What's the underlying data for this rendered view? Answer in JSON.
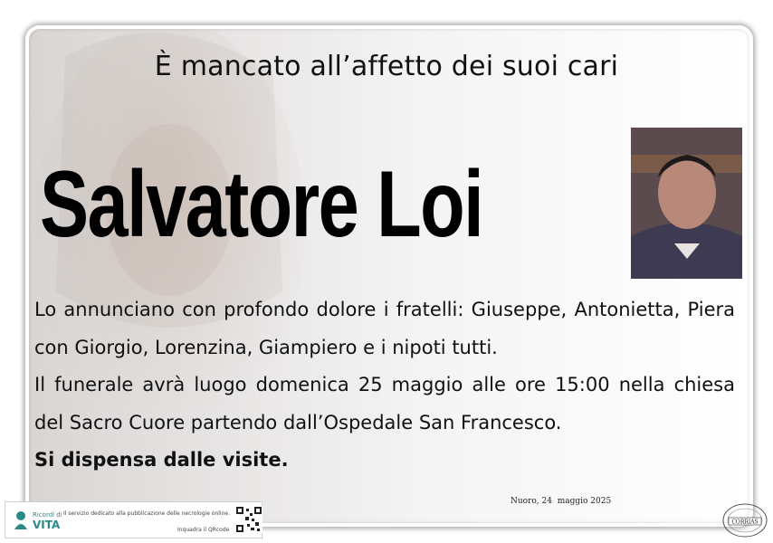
{
  "notice": {
    "heading": "È mancato all’affetto dei suoi cari",
    "name": "Salvatore Loi",
    "lines": [
      "Lo annunciano con profondo dolore i fratelli: Giuseppe, Antonietta, Piera con Giorgio, Lorenzina, Giampiero e i nipoti tutti.",
      "Il funerale avrà luogo domenica 25 maggio alle ore 15:00 nella chiesa del Sacro Cuore partendo dall’Ospedale San Francesco."
    ],
    "closing": "Si dispensa  dalle visite.",
    "date": "Nuoro, 24  maggio 2025"
  },
  "footer": {
    "brand_small": "Ricordi di",
    "brand_big": "VITA",
    "service_text": "Il servizio dedicato alla pubblicazione delle necrologie online.",
    "qr_hint": "Inquadra il QRcode",
    "seal_text": "CORRIAS"
  },
  "colors": {
    "brand": "#2b8a88",
    "text": "#111111"
  },
  "icons": [
    "ricordi-di-vita-logo-icon",
    "qr-code-icon",
    "corrias-seal-icon"
  ]
}
